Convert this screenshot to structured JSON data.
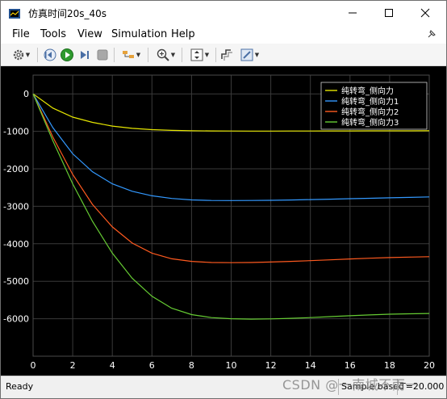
{
  "window": {
    "title": "仿真时间20s_40s",
    "minimize_glyph": "—",
    "maximize_glyph": "☐",
    "close_glyph": "✕"
  },
  "menu": [
    {
      "label": "File"
    },
    {
      "label": "Tools"
    },
    {
      "label": "View"
    },
    {
      "label": "Simulation"
    },
    {
      "label": "Help"
    }
  ],
  "toolbar_icons": [
    "settings-icon",
    "step-back-icon",
    "run-icon",
    "step-forward-icon",
    "stop-icon",
    "highlight-icon",
    "zoom-in-icon",
    "autoscale-icon",
    "signal-icon",
    "edit-icon"
  ],
  "status": {
    "ready": "Ready",
    "sample": "Sample based",
    "time": "T=20.000"
  },
  "watermark": "CSDN @一南城不雨一",
  "colors": {
    "scope_bg": "#000000",
    "grid": "#3a3a3a",
    "tick_text": "#ffffff",
    "legend_border": "#d0d0d0"
  },
  "chart_data": {
    "type": "line",
    "xlim": [
      0,
      20
    ],
    "ylim": [
      -7000,
      500
    ],
    "x_ticks": [
      0,
      2,
      4,
      6,
      8,
      10,
      12,
      14,
      16,
      18,
      20
    ],
    "y_ticks": [
      0,
      -1000,
      -2000,
      -3000,
      -4000,
      -5000,
      -6000
    ],
    "grid": true,
    "legend_position": "top-right",
    "series": [
      {
        "name": "纯转弯_侧向力",
        "color": "#e6e600",
        "x": [
          0,
          1,
          2,
          3,
          4,
          5,
          6,
          7,
          8,
          9,
          10,
          11,
          12,
          13,
          14,
          15,
          16,
          17,
          18,
          19,
          20
        ],
        "y": [
          0,
          -380,
          -620,
          -760,
          -860,
          -920,
          -955,
          -975,
          -985,
          -990,
          -992,
          -993,
          -993,
          -992,
          -991,
          -990,
          -989,
          -988,
          -987,
          -986,
          -985
        ]
      },
      {
        "name": "纯转弯_侧向力1",
        "color": "#3399ff",
        "x": [
          0,
          1,
          2,
          3,
          4,
          5,
          6,
          7,
          8,
          9,
          10,
          11,
          12,
          13,
          14,
          15,
          16,
          17,
          18,
          19,
          20
        ],
        "y": [
          0,
          -900,
          -1600,
          -2080,
          -2400,
          -2600,
          -2720,
          -2790,
          -2830,
          -2845,
          -2848,
          -2845,
          -2840,
          -2832,
          -2822,
          -2810,
          -2798,
          -2786,
          -2774,
          -2762,
          -2750
        ]
      },
      {
        "name": "纯转弯_侧向力2",
        "color": "#ff5a1f",
        "x": [
          0,
          1,
          2,
          3,
          4,
          5,
          6,
          7,
          8,
          9,
          10,
          11,
          12,
          13,
          14,
          15,
          16,
          17,
          18,
          19,
          20
        ],
        "y": [
          0,
          -1150,
          -2150,
          -2950,
          -3550,
          -3980,
          -4250,
          -4400,
          -4470,
          -4500,
          -4505,
          -4500,
          -4488,
          -4470,
          -4450,
          -4428,
          -4405,
          -4385,
          -4368,
          -4355,
          -4345
        ]
      },
      {
        "name": "纯转弯_侧向力3",
        "color": "#66cc33",
        "x": [
          0,
          1,
          2,
          3,
          4,
          5,
          6,
          7,
          8,
          9,
          10,
          11,
          12,
          13,
          14,
          15,
          16,
          17,
          18,
          19,
          20
        ],
        "y": [
          0,
          -1250,
          -2400,
          -3400,
          -4250,
          -4920,
          -5400,
          -5720,
          -5890,
          -5970,
          -6000,
          -6010,
          -6005,
          -5990,
          -5970,
          -5945,
          -5920,
          -5898,
          -5880,
          -5868,
          -5860
        ]
      }
    ]
  }
}
